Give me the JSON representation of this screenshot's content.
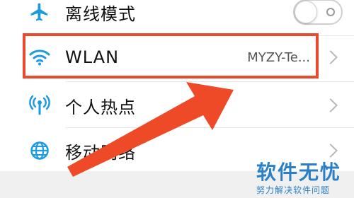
{
  "settings": {
    "items": [
      {
        "icon": "airplane-icon",
        "label": "离线模式",
        "toggle": "off"
      },
      {
        "icon": "wifi-icon",
        "label": "WLAN",
        "value": "MYZY-Te..."
      },
      {
        "icon": "hotspot-icon",
        "label": "个人热点"
      },
      {
        "icon": "globe-icon",
        "label": "移动网络"
      }
    ]
  },
  "watermark": {
    "title": "软件无忧",
    "subtitle": "努力解决软件问题"
  },
  "colors": {
    "accent": "#1e9be0",
    "highlight": "#e94a2e",
    "watermark": "#2a7fc7"
  }
}
